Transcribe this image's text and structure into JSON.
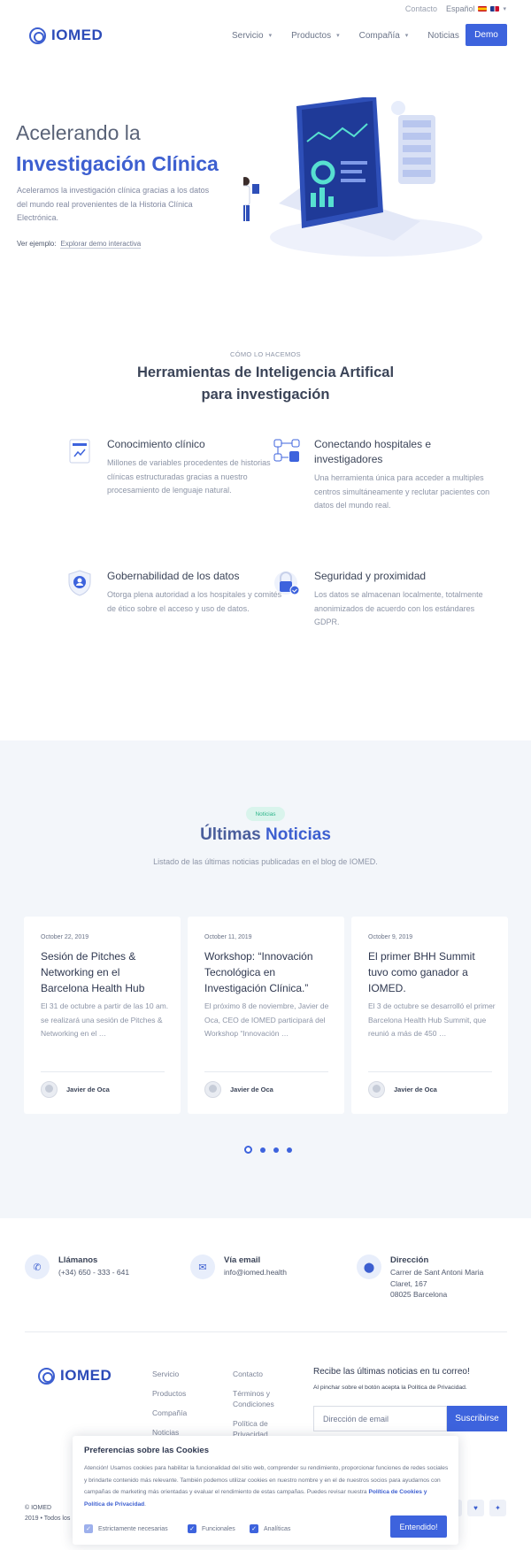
{
  "topbar": {
    "contact": "Contacto",
    "language": "Español"
  },
  "header": {
    "logo_text": "IOMED",
    "nav": [
      {
        "label": "Servicio",
        "has_menu": true
      },
      {
        "label": "Productos",
        "has_menu": true
      },
      {
        "label": "Compañía",
        "has_menu": true
      },
      {
        "label": "Noticias",
        "has_menu": false
      }
    ],
    "demo_label": "Demo"
  },
  "hero": {
    "title_line1": "Acelerando la",
    "title_line2": "Investigación Clínica",
    "description": "Aceleramos la investigación clínica gracias a los datos del mundo real provenientes de la Historia Clínica Electrónica.",
    "example_label": "Ver ejemplo:",
    "example_link": "Explorar demo interactiva"
  },
  "how": {
    "eyebrow": "CÓMO LO HACEMOS",
    "title": "Herramientas de Inteligencia Artifical para investigación",
    "features": [
      {
        "icon": "document-chart-icon",
        "title": "Conocimiento clínico",
        "text": "Millones de variables procedentes de historias clínicas estructuradas gracias a nuestro procesamiento de lenguaje natural."
      },
      {
        "icon": "network-lock-icon",
        "title": "Conectando hospitales e investigadores",
        "text": "Una herramienta única para acceder a multiples centros simultáneamente y reclutar pacientes con datos del mundo real."
      },
      {
        "icon": "shield-user-icon",
        "title": "Gobernabilidad de los datos",
        "text": "Otorga plena autoridad a los hospitales y comités de ético sobre el acceso y uso de datos."
      },
      {
        "icon": "secure-lock-icon",
        "title": "Seguridad y proximidad",
        "text": "Los datos se almacenan localmente, totalmente anonimizados de acuerdo con los estándares GDPR."
      }
    ]
  },
  "news": {
    "pill": "Noticias",
    "title_light": "Últimas",
    "title_bold": "Noticias",
    "subtitle": "Listado de las últimas noticias publicadas en el blog de IOMED.",
    "cards": [
      {
        "date": "October 22, 2019",
        "title": "Sesión de Pitches & Networking en el Barcelona Health Hub",
        "excerpt": "El 31 de octubre a partir de las 10 am. se realizará una sesión de Pitches & Networking en el …",
        "author": "Javier de Oca"
      },
      {
        "date": "October 11, 2019",
        "title": "Workshop: “Innovación Tecnológica en Investigación Clínica.”",
        "excerpt": "El próximo 8 de noviembre, Javier de Oca, CEO de IOMED participará del Workshop “Innovación …",
        "author": "Javier de Oca"
      },
      {
        "date": "October 9, 2019",
        "title": "El primer BHH Summit tuvo como ganador a IOMED.",
        "excerpt": "El 3 de octubre se desarrolló el primer Barcelona Health Hub Summit, que reunió a más de 450 …",
        "author": "Javier de Oca"
      }
    ],
    "pager_pages": 4,
    "pager_active": 1
  },
  "contact": {
    "phone": {
      "label": "Llámanos",
      "value": "(+34) 650 - 333 - 641"
    },
    "email": {
      "label": "Vía email",
      "value": "info@iomed.health"
    },
    "address": {
      "label": "Dirección",
      "line1": "Carrer de Sant Antoni Maria",
      "line2": "Claret, 167",
      "line3": "08025 Barcelona"
    }
  },
  "footer": {
    "col1": [
      "Servicio",
      "Productos",
      "Compañía",
      "Noticias"
    ],
    "col2": [
      "Contacto",
      "Términos y Condiciones",
      "Política de Privacidad"
    ],
    "newsletter_title": "Recibe las últimas noticias en tu correo!",
    "newsletter_note": "Al pinchar sobre el botón acepta la Política de Privacidad.",
    "email_placeholder": "Dirección de email",
    "subscribe_label": "Suscribirse",
    "copyright_line1": "© IOMED",
    "copyright_line2": "2019 • Todos los"
  },
  "cookies": {
    "title": "Preferencias sobre las Cookies",
    "text": "Atención! Usamos cookies para habilitar la funcionalidad del sitio web, comprender su rendimiento, proporcionar funciones de redes sociales y brindarte contenido más relevante. También podemos utilizar cookies en nuestro nombre y en el de nuestros socios para ayudarnos con campañas de marketing más orientadas y evaluar el rendimiento de estas campañas. Puedes revisar nuestra",
    "link": "Política de Cookies y Política de Privacidad",
    "options": [
      {
        "label": "Estrictamente necesarias",
        "checked": true,
        "disabled": true
      },
      {
        "label": "Funcionales",
        "checked": true,
        "disabled": false
      },
      {
        "label": "Analíticas",
        "checked": true,
        "disabled": false
      }
    ],
    "accept_label": "Entendido!"
  },
  "colors": {
    "brand": "#3d63dd",
    "news_bg": "#f3f6fa",
    "pill_green": "#2fb58b"
  }
}
